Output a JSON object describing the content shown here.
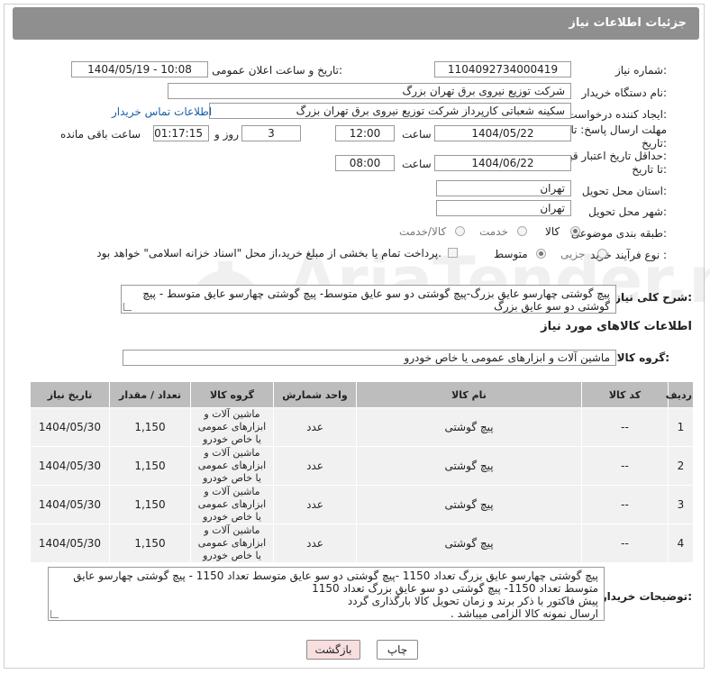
{
  "header": {
    "title": "جزئیات اطلاعات نیاز"
  },
  "form": {
    "need_number_label": "شماره نیاز:",
    "need_number": "1104092734000419",
    "announce_label": "تاریخ و ساعت اعلان عمومی:",
    "announce_value": "1404/05/19 - 10:08",
    "buyer_org_label": "نام دستگاه خریدار:",
    "buyer_org": "شرکت توزیع نیروی برق تهران بزرگ",
    "creator_label": "ایجاد کننده درخواست:",
    "creator": "سکینه شعباتی کارپرداز شرکت توزیع نیروی برق تهران بزرگ",
    "contact_link": "اطلاعات تماس خریدار",
    "deadline_label_1": "مهلت ارسال پاسخ: تا",
    "deadline_label_2": "تاریخ:",
    "deadline_date": "1404/05/22",
    "time_label": "ساعت",
    "deadline_time": "12:00",
    "days_value": "3",
    "days_label": "روز و",
    "remaining_value": "01:17:15",
    "remaining_label": "ساعت باقی مانده",
    "price_label_1": "حداقل تاریخ اعتبار قیمت:",
    "price_label_2": "تا تاریخ:",
    "price_date": "1404/06/22",
    "price_time": "08:00",
    "province_label": "استان محل تحویل:",
    "province": "تهران",
    "city_label": "شهر محل تحویل:",
    "city": "تهران",
    "category_label": "طبقه بندی موضوعی:",
    "category_options": [
      "کالا",
      "خدمت",
      "کالا/خدمت"
    ],
    "process_label": "نوع فرآیند خرید :",
    "process_options": [
      "جزیی",
      "متوسط"
    ],
    "payment_note": "پرداخت تمام یا بخشی از مبلغ خرید،از محل \"اسناد خزانه اسلامی\" خواهد بود."
  },
  "summary": {
    "label": "شرح کلی نیاز:",
    "text": "پیچ گوشتی چهارسو عایق بزرگ-پیچ گوشتی دو سو عایق متوسط- پیچ گوشتی چهارسو عایق متوسط - پیچ گوشتی دو سو عایق بزرگ"
  },
  "goods": {
    "section_title": "اطلاعات کالاهای مورد نیاز",
    "group_label": "گروه کالا:",
    "group_value": "ماشین آلات و ابزارهای عمومی یا خاص خودرو",
    "columns": [
      "ردیف",
      "کد کالا",
      "نام کالا",
      "واحد شمارش",
      "گروه کالا",
      "تعداد / مقدار",
      "تاریخ نیاز"
    ],
    "rows": [
      {
        "index": "1",
        "code": "--",
        "name": "پیچ گوشتی",
        "unit": "عدد",
        "group": "ماشین آلات و ابزارهای عمومی یا خاص خودرو",
        "qty": "1,150",
        "date": "1404/05/30"
      },
      {
        "index": "2",
        "code": "--",
        "name": "پیچ گوشتی",
        "unit": "عدد",
        "group": "ماشین آلات و ابزارهای عمومی یا خاص خودرو",
        "qty": "1,150",
        "date": "1404/05/30"
      },
      {
        "index": "3",
        "code": "--",
        "name": "پیچ گوشتی",
        "unit": "عدد",
        "group": "ماشین آلات و ابزارهای عمومی یا خاص خودرو",
        "qty": "1,150",
        "date": "1404/05/30"
      },
      {
        "index": "4",
        "code": "--",
        "name": "پیچ گوشتی",
        "unit": "عدد",
        "group": "ماشین آلات و ابزارهای عمومی یا خاص خودرو",
        "qty": "1,150",
        "date": "1404/05/30"
      }
    ]
  },
  "buyer_notes": {
    "label": "توضیحات خریدار:",
    "lines": [
      "پیچ گوشتی چهارسو عایق بزرگ تعداد 1150 -پیچ گوشتی دو سو عایق متوسط تعداد 1150 - پیچ گوشتی چهارسو عایق",
      "متوسط تعداد 1150- پیچ گوشتی دو سو عایق بزرگ تعداد 1150",
      " پیش فاکتور با ذکر برند و زمان تحویل کالا بارگذاری گردد",
      "ارسال نمونه کالا الزامی میباشد ."
    ]
  },
  "buttons": {
    "print": "چاپ",
    "back": "بازگشت"
  },
  "colors": {
    "header_bg": "#8f8f8f",
    "link": "#1a5ea8",
    "back_button_bg": "#f8dede",
    "print_button_bg": "#ffffff"
  },
  "watermark": {
    "text": "AriaTender.neT"
  }
}
